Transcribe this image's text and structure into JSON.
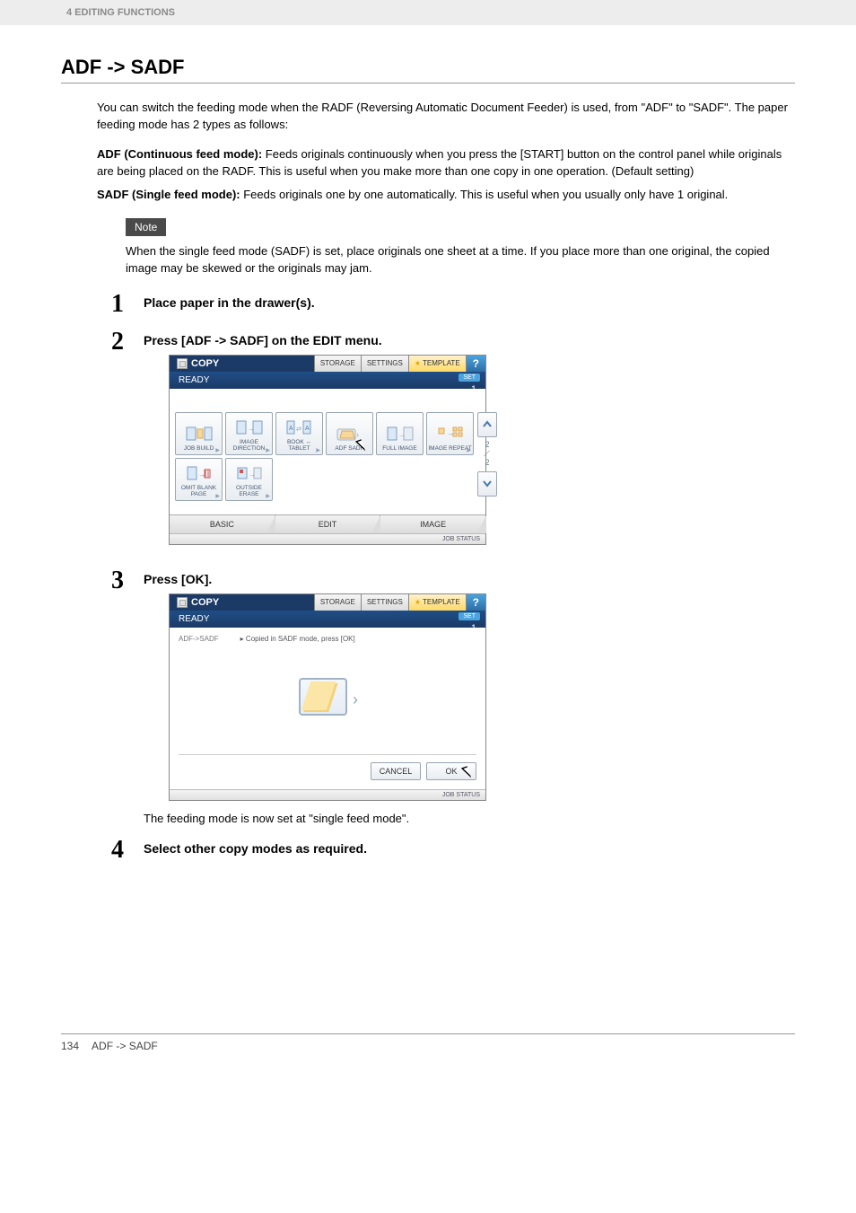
{
  "header": {
    "breadcrumb": "4 EDITING FUNCTIONS"
  },
  "title": "ADF -> SADF",
  "intro": "You can switch the feeding mode when the RADF (Reversing Automatic Document Feeder) is used, from \"ADF\" to \"SADF\". The paper feeding mode has 2 types as follows:",
  "defs": {
    "adf_term": "ADF (Continuous feed mode):",
    "adf_body": " Feeds originals continuously when you press the [START] button on the control panel while originals are being placed on the RADF. This is useful when you make more than one copy in one operation. (Default setting)",
    "sadf_term": "SADF (Single feed mode):",
    "sadf_body": " Feeds originals one by one automatically. This is useful when you usually only have 1 original."
  },
  "note": {
    "label": "Note",
    "text": "When the single feed mode (SADF) is set, place originals one sheet at a time. If you place more than one original, the copied image may be skewed or the originals may jam."
  },
  "steps": {
    "s1": {
      "num": "1",
      "title": "Place paper in the drawer(s)."
    },
    "s2": {
      "num": "2",
      "title": "Press [ADF -> SADF] on the EDIT menu."
    },
    "s3": {
      "num": "3",
      "title": "Press [OK].",
      "desc": "The feeding mode is now set at \"single feed mode\"."
    },
    "s4": {
      "num": "4",
      "title": "Select other copy modes as required."
    }
  },
  "screen_common": {
    "copy": "COPY",
    "storage": "STORAGE",
    "settings": "SETTINGS",
    "template": "TEMPLATE",
    "help": "?",
    "ready": "READY",
    "set": "SET",
    "setnum": "1",
    "jobstatus": "JOB STATUS"
  },
  "screen1": {
    "funcs": {
      "job_build": "JOB BUILD",
      "image_dir": "IMAGE DIRECTION",
      "book_tablet": "BOOK ↔ TABLET",
      "adf_sadf": "ADF SADF",
      "full_image": "FULL IMAGE",
      "image_repeat": "IMAGE REPEAT",
      "omit_blank": "OMIT BLANK PAGE",
      "outside_erase": "OUTSIDE ERASE"
    },
    "page_ind_top": "2",
    "page_ind_bot": "2",
    "tabs": {
      "basic": "BASIC",
      "edit": "EDIT",
      "image": "IMAGE"
    }
  },
  "screen2": {
    "crumb_left": "ADF->SADF",
    "crumb_msg": "▸ Copied in SADF mode, press [OK]",
    "cancel": "CANCEL",
    "ok": "OK"
  },
  "footer": {
    "page": "134",
    "title": "ADF -> SADF"
  }
}
